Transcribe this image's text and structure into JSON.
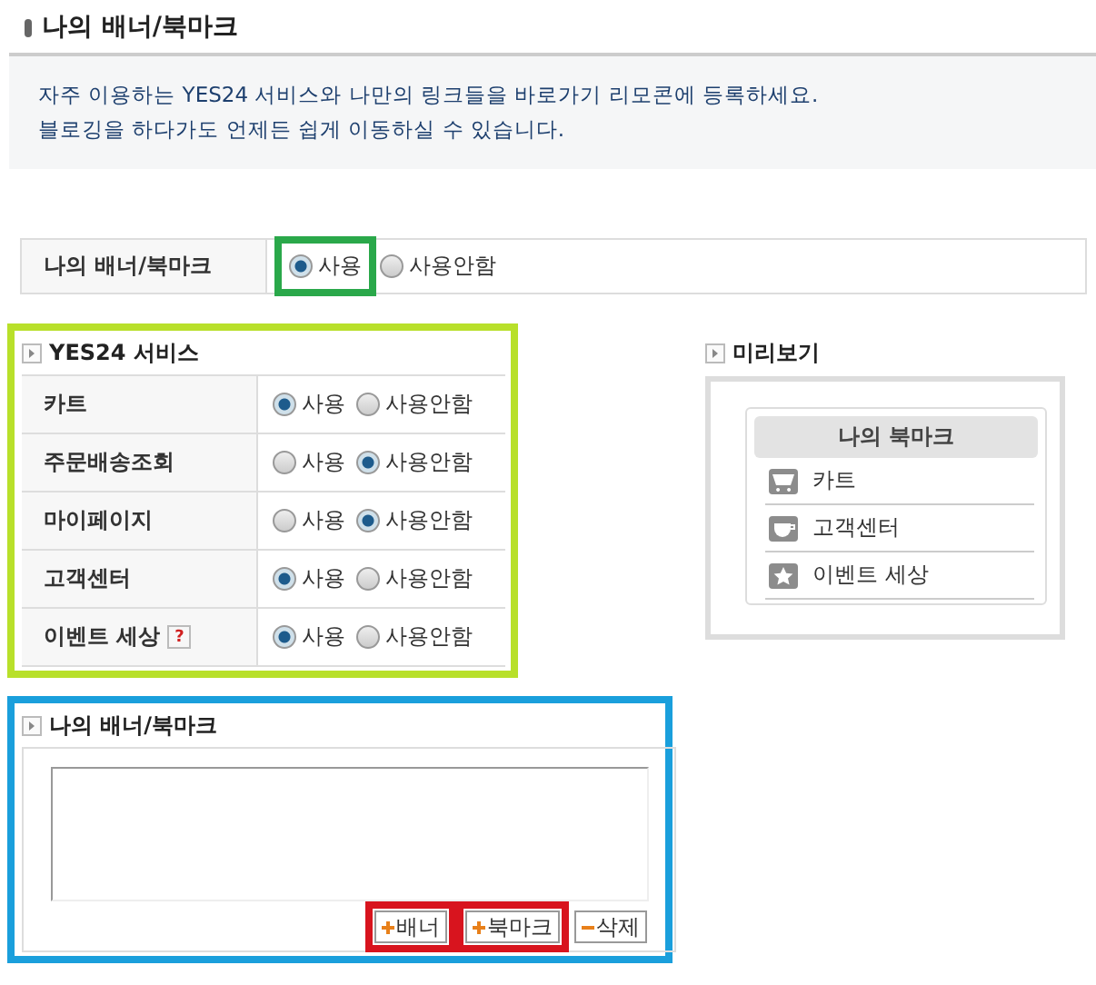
{
  "title": "나의 배너/북마크",
  "notice": [
    "자주 이용하는 YES24 서비스와 나만의 링크들을 바로가기 리모콘에 등록하세요.",
    "블로깅을 하다가도 언제든 쉽게 이동하실 수 있습니다."
  ],
  "main_setting": {
    "label": "나의 배너/북마크",
    "options": [
      {
        "label": "사용",
        "selected": true,
        "color": "#2aa84a"
      },
      {
        "label": "사용안함",
        "selected": false
      }
    ]
  },
  "services": {
    "title": "YES24 서비스",
    "color": "#b8e02a",
    "rows": [
      {
        "label": "카트",
        "options": [
          {
            "label": "사용",
            "selected": true
          },
          {
            "label": "사용안함",
            "selected": false
          }
        ]
      },
      {
        "label": "주문배송조회",
        "options": [
          {
            "label": "사용",
            "selected": false
          },
          {
            "label": "사용안함",
            "selected": true
          }
        ]
      },
      {
        "label": "마이페이지",
        "options": [
          {
            "label": "사용",
            "selected": false
          },
          {
            "label": "사용안함",
            "selected": true
          }
        ]
      },
      {
        "label": "고객센터",
        "options": [
          {
            "label": "사용",
            "selected": true
          },
          {
            "label": "사용안함",
            "selected": false
          }
        ]
      },
      {
        "label": "이벤트 세상",
        "help": "?",
        "options": [
          {
            "label": "사용",
            "selected": true
          },
          {
            "label": "사용안함",
            "selected": false
          }
        ]
      }
    ]
  },
  "preview": {
    "title": "미리보기",
    "heading": "나의 북마크",
    "items": [
      {
        "label": "카트",
        "kind": "cart"
      },
      {
        "label": "고객센터",
        "kind": "cup"
      },
      {
        "label": "이벤트 세상",
        "kind": "star"
      }
    ]
  },
  "banner": {
    "title": "나의 배너/북마크",
    "color": "#1a9fdc",
    "buttons": [
      {
        "label": "배너",
        "kind": "add",
        "color": "#d8141e"
      },
      {
        "label": "북마크",
        "kind": "add",
        "color": "#d8141e"
      },
      {
        "label": "삭제",
        "kind": "remove"
      }
    ]
  }
}
